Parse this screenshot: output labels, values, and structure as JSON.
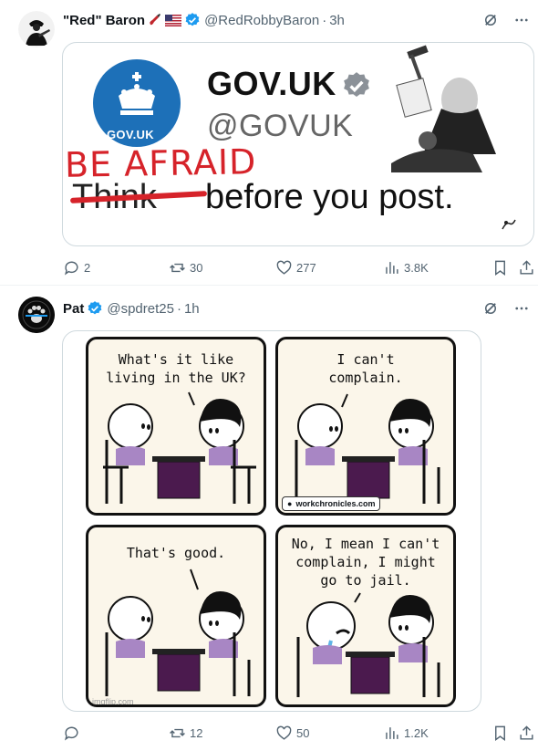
{
  "tweets": [
    {
      "name": "\"Red\" Baron",
      "handle": "@RedRobbyBaron",
      "time": "3h",
      "image": {
        "logo_text": "GOV.UK",
        "title": "GOV.UK",
        "handle": "@GOVUK",
        "overlay_red": "BE AFRAID",
        "struck_word": "Think",
        "tagline": "before you post."
      },
      "stats": {
        "replies": "2",
        "reposts": "30",
        "likes": "277",
        "views": "3.8K"
      }
    },
    {
      "name": "Pat",
      "handle": "@spdret25",
      "time": "1h",
      "comic": {
        "panel1": "What's it like\nliving in the UK?",
        "panel2": "I can't\ncomplain.",
        "panel3": "That's good.",
        "panel4": "No, I mean I can't\ncomplain, I might\ngo to jail.",
        "watermark": "workchronicles.com",
        "imgflip": "imgflip.com"
      },
      "stats": {
        "replies": "",
        "reposts": "12",
        "likes": "50",
        "views": "1.2K"
      }
    }
  ],
  "colors": {
    "verified": "#1d9bf0",
    "muted": "#536471",
    "govuk_blue": "#1d70b8",
    "red": "#d6232a",
    "purple_shirt": "#a886c4",
    "desk": "#4b1a4e"
  },
  "icons": [
    "grok-icon",
    "more-icon",
    "reply-icon",
    "repost-icon",
    "like-icon",
    "views-icon",
    "bookmark-icon",
    "share-icon",
    "verified-icon"
  ]
}
